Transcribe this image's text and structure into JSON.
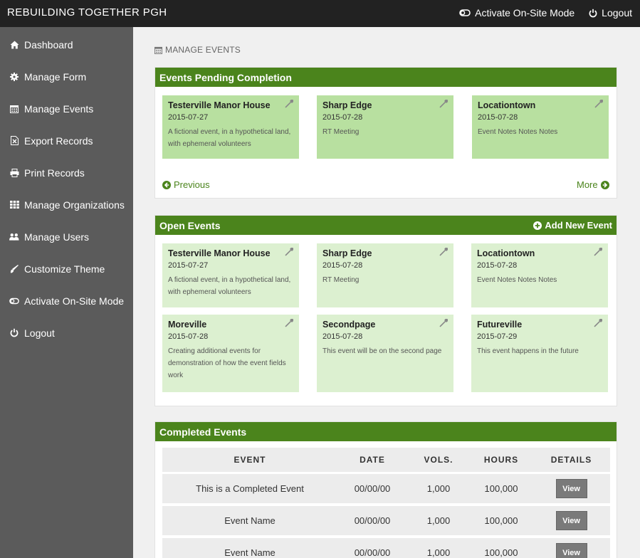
{
  "brand": "REBUILDING TOGETHER PGH",
  "topbar": {
    "onsite_label": "Activate On-Site Mode",
    "logout_label": "Logout"
  },
  "sidebar": {
    "items": [
      {
        "label": "Dashboard",
        "icon": "home-icon"
      },
      {
        "label": "Manage Form",
        "icon": "gear-icon"
      },
      {
        "label": "Manage Events",
        "icon": "calendar-icon"
      },
      {
        "label": "Export Records",
        "icon": "export-file-icon"
      },
      {
        "label": "Print Records",
        "icon": "printer-icon"
      },
      {
        "label": "Manage Organizations",
        "icon": "grid-icon"
      },
      {
        "label": "Manage Users",
        "icon": "users-icon"
      },
      {
        "label": "Customize Theme",
        "icon": "brush-icon"
      },
      {
        "label": "Activate On-Site Mode",
        "icon": "toggle-icon"
      },
      {
        "label": "Logout",
        "icon": "power-icon"
      }
    ]
  },
  "breadcrumb": "MANAGE EVENTS",
  "pending": {
    "title": "Events Pending Completion",
    "previous": "Previous",
    "more": "More",
    "cards": [
      {
        "title": "Testerville Manor House",
        "date": "2015-07-27",
        "desc": "A fictional event, in a hypothetical land, with ephemeral volunteers"
      },
      {
        "title": "Sharp Edge",
        "date": "2015-07-28",
        "desc": "RT Meeting"
      },
      {
        "title": "Locationtown",
        "date": "2015-07-28",
        "desc": "Event Notes Notes Notes"
      }
    ]
  },
  "open": {
    "title": "Open Events",
    "add_label": "Add New Event",
    "cards": [
      {
        "title": "Testerville Manor House",
        "date": "2015-07-27",
        "desc": "A fictional event, in a hypothetical land, with ephemeral volunteers"
      },
      {
        "title": "Sharp Edge",
        "date": "2015-07-28",
        "desc": "RT Meeting"
      },
      {
        "title": "Locationtown",
        "date": "2015-07-28",
        "desc": "Event Notes Notes Notes"
      },
      {
        "title": "Moreville",
        "date": "2015-07-28",
        "desc": "Creating additional events for demonstration of how the event fields work"
      },
      {
        "title": "Secondpage",
        "date": "2015-07-28",
        "desc": "This event will be on the second page"
      },
      {
        "title": "Futureville",
        "date": "2015-07-29",
        "desc": "This event happens in the future"
      }
    ]
  },
  "completed": {
    "title": "Completed Events",
    "columns": [
      "EVENT",
      "DATE",
      "VOLS.",
      "HOURS",
      "DETAILS"
    ],
    "rows": [
      {
        "event": "This is a Completed Event",
        "date": "00/00/00",
        "vols": "1,000",
        "hours": "100,000",
        "action": "View"
      },
      {
        "event": "Event Name",
        "date": "00/00/00",
        "vols": "1,000",
        "hours": "100,000",
        "action": "View"
      },
      {
        "event": "Event Name",
        "date": "00/00/00",
        "vols": "1,000",
        "hours": "100,000",
        "action": "View"
      }
    ]
  },
  "colors": {
    "header_green": "#4b841c",
    "pending_card": "#b8e0a0",
    "open_card": "#dcf0d0",
    "topbar": "#222222",
    "sidebar": "#5b5b5b"
  }
}
